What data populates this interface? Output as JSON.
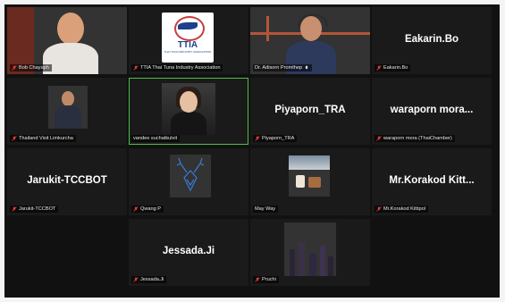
{
  "participants": [
    {
      "name": "Bob Chayaph",
      "display": "",
      "row": 0,
      "col": 0
    },
    {
      "name": "TTIA Thai Tuna Industry Association",
      "display": "",
      "row": 0,
      "col": 1
    },
    {
      "name": "Dr. Adisorn Promthep",
      "display": "",
      "row": 0,
      "col": 2
    },
    {
      "name": "Eakarin.Bo",
      "display": "Eakarin.Bo",
      "row": 0,
      "col": 3
    },
    {
      "name": "Thailand Visit Limkurcha",
      "display": "",
      "row": 1,
      "col": 0
    },
    {
      "name": "vandee suchatkulvit",
      "display": "",
      "row": 1,
      "col": 1
    },
    {
      "name": "Piyaporn_TRA",
      "display": "Piyaporn_TRA",
      "row": 1,
      "col": 2
    },
    {
      "name": "waraporn mora (ThaiChamber)",
      "display": "waraporn  mora...",
      "row": 1,
      "col": 3
    },
    {
      "name": "Jarukit-TCCBOT",
      "display": "Jarukit-TCCBOT",
      "row": 2,
      "col": 0
    },
    {
      "name": "Qwang P",
      "display": "",
      "row": 2,
      "col": 1
    },
    {
      "name": "May Way",
      "display": "",
      "row": 2,
      "col": 2
    },
    {
      "name": "Mr.Korakod Kittipol",
      "display": "Mr.Korakod  Kitt...",
      "row": 2,
      "col": 3
    },
    {
      "name": "Jessada.Ji",
      "display": "Jessada.Ji",
      "row": 3,
      "col": 1
    },
    {
      "name": "Pruchi",
      "display": "",
      "row": 3,
      "col": 2
    }
  ],
  "logo": {
    "text": "TTIA",
    "subtext": "THAI TUNA INDUSTRY ASSOCIATION"
  },
  "colors": {
    "mic_muted": "#e03a3a",
    "active_speaker": "#4fbf45",
    "background": "#111111"
  },
  "icons": {
    "muted": "mic-muted-icon",
    "unmuted": "mic-on-icon"
  }
}
